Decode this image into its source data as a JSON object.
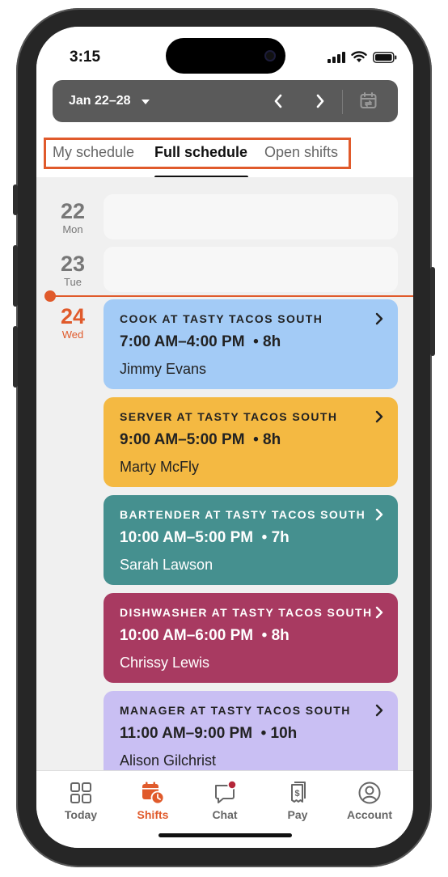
{
  "status_bar": {
    "time": "3:15"
  },
  "week_selector": {
    "label": "Jan 22–28"
  },
  "tabs": [
    {
      "label": "My schedule",
      "active": false
    },
    {
      "label": "Full schedule",
      "active": true
    },
    {
      "label": "Open shifts",
      "active": false
    }
  ],
  "days": [
    {
      "num": "22",
      "name": "Mon"
    },
    {
      "num": "23",
      "name": "Tue"
    },
    {
      "num": "24",
      "name": "Wed"
    }
  ],
  "shifts": [
    {
      "title": "COOK AT TASTY TACOS SOUTH",
      "time": "7:00 AM–4:00 PM",
      "hours": "• 8h",
      "person": "Jimmy Evans",
      "color": "#a3cbf6"
    },
    {
      "title": "SERVER AT TASTY TACOS SOUTH",
      "time": "9:00 AM–5:00 PM",
      "hours": "• 8h",
      "person": "Marty McFly",
      "color": "#f4b942"
    },
    {
      "title": "BARTENDER AT TASTY TACOS SOUTH",
      "time": "10:00 AM–5:00 PM",
      "hours": "• 7h",
      "person": "Sarah Lawson",
      "color": "#45908f"
    },
    {
      "title": "DISHWASHER AT TASTY TACOS SOUTH",
      "time": "10:00 AM–6:00 PM",
      "hours": "• 8h",
      "person": "Chrissy Lewis",
      "color": "#a83a61"
    },
    {
      "title": "MANAGER AT TASTY TACOS SOUTH",
      "time": "11:00 AM–9:00 PM",
      "hours": "• 10h",
      "person": "Alison Gilchrist",
      "color": "#c9bff3"
    }
  ],
  "tab_bar": [
    {
      "label": "Today",
      "icon": "grid-icon"
    },
    {
      "label": "Shifts",
      "icon": "calendar-clock-icon",
      "active": true
    },
    {
      "label": "Chat",
      "icon": "chat-bubble-icon"
    },
    {
      "label": "Pay",
      "icon": "receipt-dollar-icon"
    },
    {
      "label": "Account",
      "icon": "user-circle-icon"
    }
  ],
  "colors": {
    "accent": "#e05a2b",
    "header_bar": "#5a5a5a"
  }
}
